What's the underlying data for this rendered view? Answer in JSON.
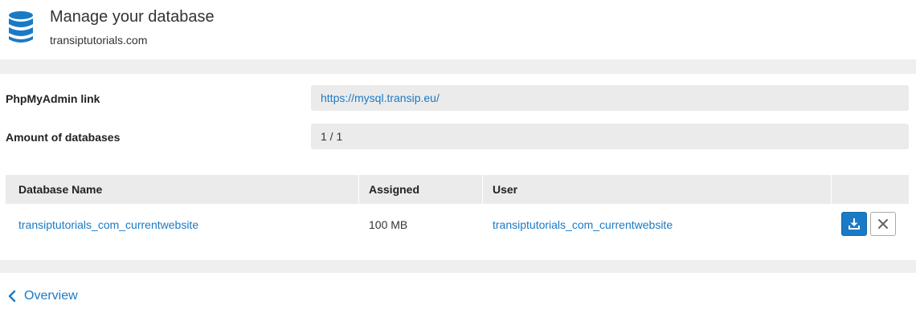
{
  "header": {
    "icon": "database-icon",
    "title": "Manage your database",
    "subtitle": "transiptutorials.com"
  },
  "info": {
    "phpmyadmin_label": "PhpMyAdmin link",
    "phpmyadmin_url": "https://mysql.transip.eu/",
    "amount_label": "Amount of databases",
    "amount_value": "1 / 1"
  },
  "table": {
    "columns": [
      "Database Name",
      "Assigned",
      "User",
      ""
    ],
    "rows": [
      {
        "name": "transiptutorials_com_currentwebsite",
        "assigned": "100 MB",
        "user": "transiptutorials_com_currentwebsite",
        "actions": [
          "download-icon",
          "close-icon"
        ]
      }
    ]
  },
  "footer": {
    "back_icon": "chevron-left-icon",
    "back_label": "Overview"
  },
  "colors": {
    "accent": "#1a7ac5",
    "band": "#efefef",
    "field": "#ebebeb"
  }
}
